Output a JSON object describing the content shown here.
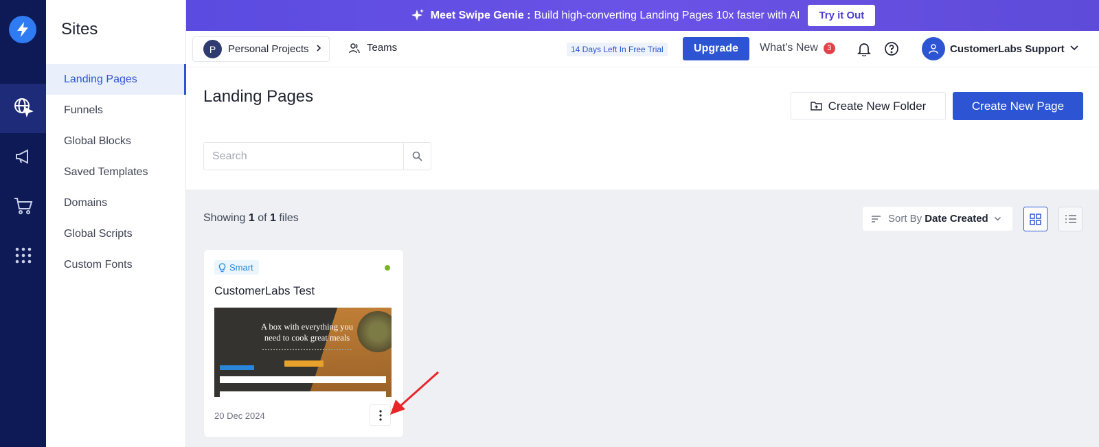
{
  "colors": {
    "rail": "#0e1a55",
    "accent": "#2d55d3",
    "banner": "#5b4be0",
    "alert": "#e0424a",
    "status_live": "#7ab51d"
  },
  "rail": {
    "items": [
      {
        "icon": "globe-cursor-icon",
        "active": true
      },
      {
        "icon": "megaphone-icon",
        "active": false
      },
      {
        "icon": "cart-icon",
        "active": false
      },
      {
        "icon": "apps-grid-icon",
        "active": false
      }
    ]
  },
  "sites": {
    "title": "Sites",
    "nav": [
      "Landing Pages",
      "Funnels",
      "Global Blocks",
      "Saved Templates",
      "Domains",
      "Global Scripts",
      "Custom Fonts"
    ],
    "active_index": 0
  },
  "banner": {
    "strong": "Meet Swipe Genie :",
    "text": "Build high-converting Landing Pages 10x faster with AI",
    "button": "Try it Out"
  },
  "topbar": {
    "project_initial": "P",
    "project": "Personal Projects",
    "teams": "Teams",
    "trial": "14 Days Left In Free Trial",
    "upgrade": "Upgrade",
    "whats_new": "What's New",
    "whats_new_count": "3",
    "user": "CustomerLabs Support"
  },
  "main": {
    "title": "Landing Pages",
    "create_folder": "Create New Folder",
    "create_page": "Create New Page",
    "search_placeholder": "Search",
    "showing_prefix": "Showing",
    "showing_count": "1",
    "showing_of": "of",
    "showing_total": "1",
    "showing_suffix": "files",
    "sort_label": "Sort By",
    "sort_value": "Date Created",
    "view_mode": "grid"
  },
  "card": {
    "badge": "Smart",
    "title": "CustomerLabs Test",
    "date": "20 Dec 2024",
    "thumb_headline_1": "A box with everything you",
    "thumb_headline_2": "need to cook great meals"
  }
}
